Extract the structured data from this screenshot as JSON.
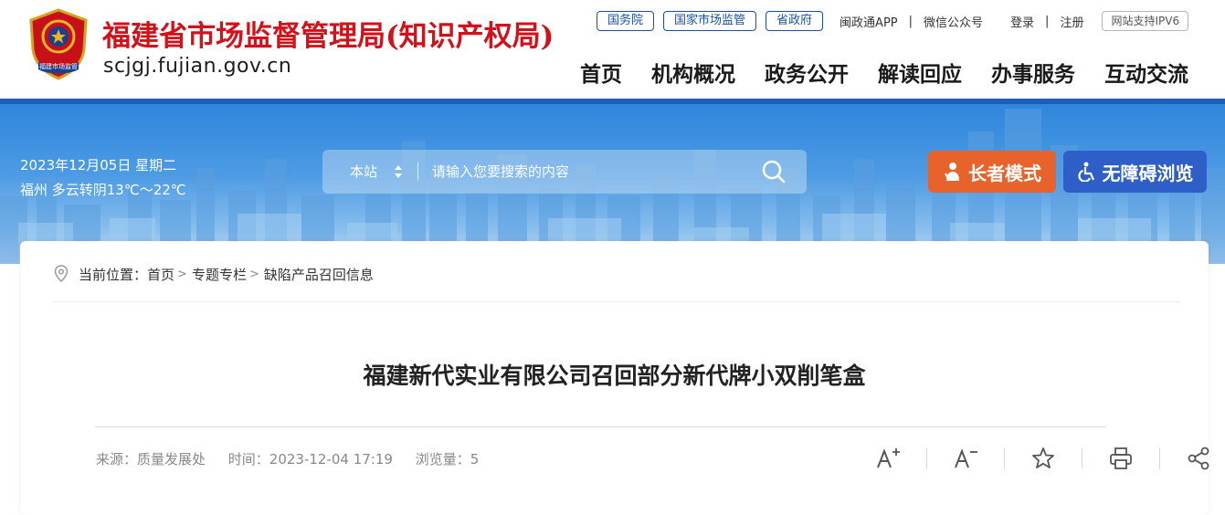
{
  "header": {
    "site_name": "福建省市场监督管理局(知识产权局)",
    "domain": "scjgj.fujian.gov.cn",
    "emblem_text": "福建市场监管",
    "top_links": [
      "国务院",
      "国家市场监管",
      "省政府"
    ],
    "app_link": "闽政通APP",
    "wechat_link": "微信公众号",
    "login": "登录",
    "register": "注册",
    "ipv6": "网站支持IPV6",
    "nav": [
      "首页",
      "机构概况",
      "政务公开",
      "解读回应",
      "办事服务",
      "互动交流"
    ]
  },
  "banner": {
    "date": "2023年12月05日 星期二",
    "weather": "福州 多云转阴13℃～22℃",
    "search_scope": "本站",
    "search_placeholder": "请输入您要搜索的内容",
    "elder_mode": "长者模式",
    "accessible": "无障碍浏览"
  },
  "breadcrumb": {
    "prefix": "当前位置：",
    "items": [
      "首页",
      "专题专栏",
      "缺陷产品召回信息"
    ]
  },
  "article": {
    "title": "福建新代实业有限公司召回部分新代牌小双削笔盒",
    "source": "来源：质量发展处",
    "time": "时间：2023-12-04 17:19",
    "views": "浏览量：5"
  },
  "tools": [
    "font-increase-icon",
    "font-decrease-icon",
    "favorite-star-icon",
    "print-icon",
    "share-icon"
  ],
  "colors": {
    "brand_red": "#d4101a",
    "nav_blue": "#1c5fb9",
    "elder_orange": "#e8632b",
    "access_blue": "#2e5ec8"
  }
}
